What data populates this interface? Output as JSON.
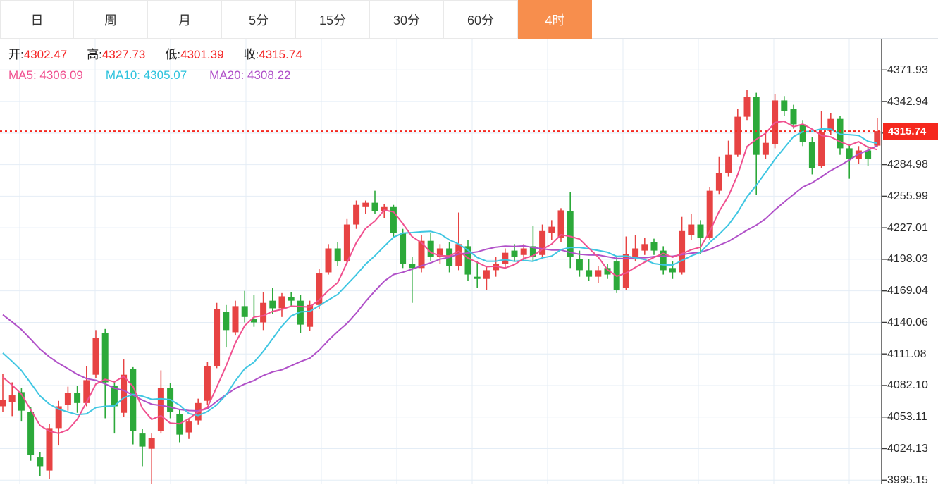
{
  "toolbar": {
    "tabs": [
      {
        "key": "day",
        "label": "日",
        "active": false
      },
      {
        "key": "week",
        "label": "周",
        "active": false
      },
      {
        "key": "month",
        "label": "月",
        "active": false
      },
      {
        "key": "5min",
        "label": "5分",
        "active": false
      },
      {
        "key": "15min",
        "label": "15分",
        "active": false
      },
      {
        "key": "30min",
        "label": "30分",
        "active": false
      },
      {
        "key": "60min",
        "label": "60分",
        "active": false
      },
      {
        "key": "4hour",
        "label": "4时",
        "active": true
      }
    ],
    "active_tab_color": "#f78e4d"
  },
  "ohlc": {
    "items": [
      {
        "key": "open",
        "label": "开:",
        "value": "4302.47"
      },
      {
        "key": "high",
        "label": "高:",
        "value": "4327.73"
      },
      {
        "key": "low",
        "label": "低:",
        "value": "4301.39"
      },
      {
        "key": "close",
        "label": "收:",
        "value": "4315.74"
      }
    ],
    "value_color": "#f52222"
  },
  "ma_readout": {
    "items": [
      {
        "key": "ma5",
        "label": "MA5:",
        "value": "4306.09",
        "color": "#f0508f"
      },
      {
        "key": "ma10",
        "label": "MA10:",
        "value": "4305.07",
        "color": "#2ec3dd"
      },
      {
        "key": "ma20",
        "label": "MA20:",
        "value": "4308.22",
        "color": "#b050c8"
      }
    ]
  },
  "price_line": {
    "value": "4315.74",
    "color": "#f5281e"
  },
  "y_axis": {
    "labels": [
      "4371.93",
      "4342.94",
      "4284.98",
      "4255.99",
      "4227.01",
      "4198.03",
      "4169.04",
      "4140.06",
      "4111.08",
      "4082.10",
      "4053.11",
      "4024.13",
      "3995.15"
    ]
  },
  "chart_data": {
    "type": "candlestick",
    "interval": "4时",
    "up_color": "#e74343",
    "down_color": "#2ca93a",
    "grid_color": "#e4edf6",
    "axis_color": "#3c3c3c",
    "current_price": 4315.74,
    "axis": {
      "price_at_first_gridline": 4371.93,
      "gridline_step": 28.985,
      "visible_min": 3991,
      "visible_max": 4400
    },
    "grid_prices": [
      4371.93,
      4342.94,
      4313.96,
      4284.98,
      4255.99,
      4227.01,
      4198.03,
      4169.04,
      4140.06,
      4111.08,
      4082.1,
      4053.11,
      4024.13,
      3995.15
    ],
    "ma": [
      {
        "period": 5,
        "color": "#f0508f",
        "current": 4306.09
      },
      {
        "period": 10,
        "color": "#3fc6e2",
        "current": 4305.07
      },
      {
        "period": 20,
        "color": "#b050c8",
        "current": 4308.22
      }
    ],
    "prehistory_closes": [
      4210,
      4205,
      4200,
      4195,
      4190,
      4185,
      4180,
      4175,
      4170,
      4165,
      4158,
      4150,
      4142,
      4134,
      4126,
      4118,
      4110,
      4100,
      4090,
      4080
    ],
    "candles": [
      [
        4063,
        4093,
        4058,
        4069
      ],
      [
        4067,
        4085,
        4054,
        4073
      ],
      [
        4076,
        4080,
        4049,
        4059
      ],
      [
        4058,
        4062,
        4013,
        4018
      ],
      [
        4016,
        4021,
        3999,
        4008
      ],
      [
        4004,
        4047,
        3996,
        4043
      ],
      [
        4043,
        4068,
        4027,
        4063
      ],
      [
        4064,
        4081,
        4059,
        4075
      ],
      [
        4075,
        4082,
        4057,
        4066
      ],
      [
        4066,
        4100,
        4063,
        4087
      ],
      [
        4092,
        4133,
        4089,
        4126
      ],
      [
        4130,
        4134,
        4052,
        4085
      ],
      [
        4082,
        4086,
        4038,
        4063
      ],
      [
        4057,
        4106,
        4053,
        4092
      ],
      [
        4097,
        4099,
        4028,
        4040
      ],
      [
        4038,
        4042,
        4008,
        4026
      ],
      [
        4024,
        4038,
        3991,
        4034
      ],
      [
        4040,
        4096,
        4038,
        4080
      ],
      [
        4080,
        4084,
        4052,
        4058
      ],
      [
        4056,
        4060,
        4030,
        4037
      ],
      [
        4039,
        4052,
        4033,
        4049
      ],
      [
        4050,
        4070,
        4046,
        4066
      ],
      [
        4068,
        4104,
        4064,
        4100
      ],
      [
        4100,
        4158,
        4098,
        4152
      ],
      [
        4150,
        4156,
        4117,
        4133
      ],
      [
        4131,
        4160,
        4128,
        4155
      ],
      [
        4155,
        4169,
        4140,
        4145
      ],
      [
        4143,
        4165,
        4136,
        4140
      ],
      [
        4140,
        4168,
        4133,
        4158
      ],
      [
        4160,
        4172,
        4148,
        4153
      ],
      [
        4153,
        4167,
        4145,
        4164
      ],
      [
        4163,
        4168,
        4155,
        4160
      ],
      [
        4160,
        4165,
        4130,
        4138
      ],
      [
        4136,
        4160,
        4132,
        4156
      ],
      [
        4156,
        4189,
        4152,
        4185
      ],
      [
        4186,
        4212,
        4184,
        4208
      ],
      [
        4208,
        4214,
        4192,
        4196
      ],
      [
        4196,
        4235,
        4194,
        4230
      ],
      [
        4230,
        4252,
        4226,
        4248
      ],
      [
        4246,
        4252,
        4240,
        4250
      ],
      [
        4250,
        4261,
        4240,
        4242
      ],
      [
        4242,
        4249,
        4236,
        4246
      ],
      [
        4246,
        4248,
        4218,
        4222
      ],
      [
        4222,
        4226,
        4190,
        4194
      ],
      [
        4194,
        4200,
        4158,
        4190
      ],
      [
        4190,
        4220,
        4186,
        4215
      ],
      [
        4215,
        4222,
        4196,
        4200
      ],
      [
        4200,
        4212,
        4194,
        4208
      ],
      [
        4208,
        4214,
        4186,
        4192
      ],
      [
        4192,
        4241,
        4188,
        4212
      ],
      [
        4210,
        4216,
        4178,
        4184
      ],
      [
        4182,
        4196,
        4172,
        4180
      ],
      [
        4180,
        4192,
        4170,
        4188
      ],
      [
        4188,
        4200,
        4182,
        4194
      ],
      [
        4194,
        4208,
        4190,
        4204
      ],
      [
        4206,
        4212,
        4196,
        4200
      ],
      [
        4202,
        4212,
        4196,
        4208
      ],
      [
        4210,
        4229,
        4196,
        4200
      ],
      [
        4202,
        4230,
        4198,
        4224
      ],
      [
        4222,
        4234,
        4216,
        4228
      ],
      [
        4218,
        4245,
        4214,
        4243
      ],
      [
        4242,
        4260,
        4190,
        4200
      ],
      [
        4198,
        4206,
        4182,
        4188
      ],
      [
        4188,
        4198,
        4178,
        4182
      ],
      [
        4182,
        4192,
        4176,
        4188
      ],
      [
        4190,
        4194,
        4180,
        4184
      ],
      [
        4196,
        4200,
        4167,
        4170
      ],
      [
        4172,
        4219,
        4170,
        4203
      ],
      [
        4200,
        4220,
        4196,
        4208
      ],
      [
        4206,
        4218,
        4202,
        4212
      ],
      [
        4214,
        4217,
        4202,
        4206
      ],
      [
        4206,
        4210,
        4184,
        4188
      ],
      [
        4190,
        4196,
        4180,
        4186
      ],
      [
        4186,
        4237,
        4184,
        4224
      ],
      [
        4220,
        4240,
        4216,
        4230
      ],
      [
        4230,
        4234,
        4203,
        4218
      ],
      [
        4218,
        4264,
        4216,
        4261
      ],
      [
        4261,
        4292,
        4258,
        4277
      ],
      [
        4277,
        4307,
        4274,
        4294
      ],
      [
        4294,
        4336,
        4292,
        4329
      ],
      [
        4329,
        4354,
        4326,
        4347
      ],
      [
        4347,
        4351,
        4257,
        4294
      ],
      [
        4294,
        4316,
        4290,
        4305
      ],
      [
        4304,
        4350,
        4300,
        4344
      ],
      [
        4344,
        4348,
        4330,
        4334
      ],
      [
        4336,
        4340,
        4318,
        4322
      ],
      [
        4322,
        4326,
        4302,
        4306
      ],
      [
        4306,
        4310,
        4276,
        4282
      ],
      [
        4284,
        4334,
        4282,
        4315
      ],
      [
        4316,
        4332,
        4312,
        4327
      ],
      [
        4327,
        4330,
        4294,
        4300
      ],
      [
        4300,
        4304,
        4272,
        4290
      ],
      [
        4290,
        4302,
        4286,
        4298
      ],
      [
        4298,
        4302,
        4284,
        4290
      ],
      [
        4302.47,
        4327.73,
        4301.39,
        4315.74
      ]
    ]
  }
}
